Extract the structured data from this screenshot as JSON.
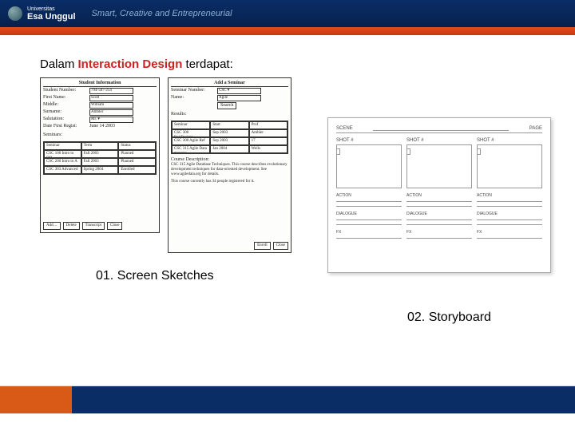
{
  "header": {
    "university_prefix": "Universitas",
    "university_name": "Esa Unggul",
    "slogan": "Smart, Creative and Entrepreneurial"
  },
  "intro": {
    "before": "Dalam ",
    "keyword": "Interaction Design",
    "after": " terdapat:"
  },
  "sketch1": {
    "title": "Student Information",
    "fields": {
      "num_label": "Student Number:",
      "num_val": "794-587-254",
      "first_label": "First Name:",
      "first_val": "Scott",
      "mid_label": "Middle:",
      "mid_val": "William",
      "sur_label": "Surname:",
      "sur_val": "Ambler",
      "sal_label": "Salutation:",
      "sal_val": "Mr. ▾",
      "date_label": "Date First Regist:",
      "date_val": "June 14 2003"
    },
    "tbl_header": "Seminars:",
    "tbl": {
      "h1": "Seminar",
      "h2": "Term",
      "h3": "Status",
      "r1c1": "CSC 100 Intro to OO",
      "r1c2": "Fall 2003",
      "r1c3": "Planned",
      "r2c1": "CSC 200 Intro to A",
      "r2c2": "Fall 2003",
      "r2c3": "Planned",
      "r3c1": "CSC 303 Advanced",
      "r3c2": "Spring 2004",
      "r3c3": "Enrolled"
    },
    "buttons": {
      "b1": "Add…",
      "b2": "Delete",
      "b3": "Transcript",
      "b4": "Close"
    }
  },
  "sketch2": {
    "title": "Add a Seminar",
    "fields": {
      "num_label": "Seminar Number:",
      "num_val": "CSC ▾",
      "name_label": "Name:",
      "name_val": "Agile",
      "btn": "Search"
    },
    "results_label": "Results:",
    "tbl": {
      "h1": "Seminar",
      "h2": "Start",
      "h3": "Prof",
      "r1c1": "CSC 300 Rel.Designs",
      "r1c2": "Sep 2003",
      "r1c3": "Ambler",
      "r2c1": "CSC 300 Agile Ref",
      "r2c2": "Sep 2003",
      "r2c3": "17",
      "r3c1": "CSC 315 Agile Data manage",
      "r3c2": "Jan 2004",
      "r3c3": "Wells"
    },
    "desc_label": "Course Description:",
    "desc_body": "CSC 315 Agile Database Techniques. This course describes evolutionary development techniques for data-oriented development. See www.agiledata.org for details.",
    "desc_foot": "This course currently has 34 people registered for it.",
    "buttons": {
      "b1": "Enroll",
      "b2": "Close"
    }
  },
  "storyboard": {
    "scene": "SCENE",
    "page": "PAGE",
    "shot": "SHOT #",
    "action": "ACTION",
    "dialogue": "DIALOGUE",
    "fx": "FX"
  },
  "caption1": "01. Screen Sketches",
  "caption2": "02. Storyboard"
}
